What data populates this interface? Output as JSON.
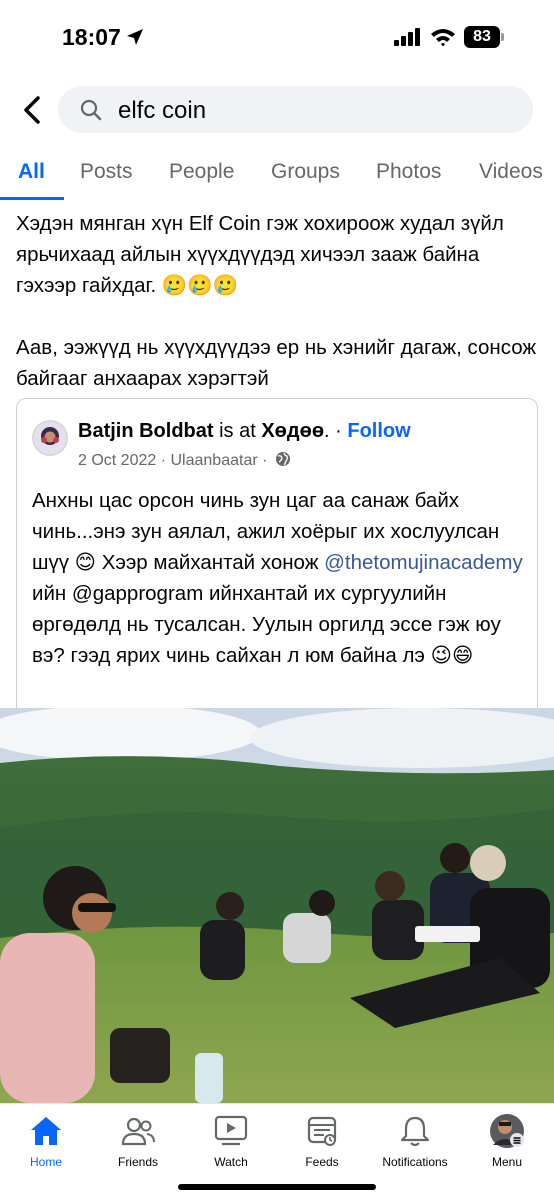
{
  "status_bar": {
    "time": "18:07",
    "battery": "83"
  },
  "search": {
    "query": "elfc coin"
  },
  "tabs": [
    {
      "label": "All",
      "active": true
    },
    {
      "label": "Posts"
    },
    {
      "label": "People"
    },
    {
      "label": "Groups"
    },
    {
      "label": "Photos"
    },
    {
      "label": "Videos"
    }
  ],
  "post": {
    "paragraph1": "Хэдэн мянган хүн Elf Coin гэж хохироож худал зүйл ярьчихаад айлын хүүхдүүдэд хичээл зааж байна гэхээр гайхдаг. 🥲🥲🥲",
    "paragraph2": "Аав, ээжүүд нь хүүхдүүдээ ер нь хэнийг дагаж, сонсож байгааг анхаарах хэрэгтэй"
  },
  "shared": {
    "author": "Batjin Boldbat",
    "is_at": " is at ",
    "place": "Хөдөө",
    "dot": ". · ",
    "follow": "Follow",
    "date": "2 Oct 2022",
    "meta_sep": " · ",
    "location": "Ulaanbaatar",
    "meta_sep2": " · ",
    "text_before": "Анхны цас орсон чинь зун цаг аа санаж байх чинь...энэ зун аялал, ажил хоёрыг их хослуулсан шүү 😊 Хээр майхантай хонож ",
    "mention": "@thetomujinacademy",
    "text_after": " ийн @gapprogram ийнхантай их сургуулийн өргөдөлд нь тусалсан. Уулын оргилд эссе гэж юу вэ? гээд ярих чинь сайхан л юм байна лэ 😉😄"
  },
  "nav": [
    {
      "label": "Home",
      "icon": "home-icon",
      "active": true
    },
    {
      "label": "Friends",
      "icon": "friends-icon"
    },
    {
      "label": "Watch",
      "icon": "watch-icon"
    },
    {
      "label": "Feeds",
      "icon": "feeds-icon"
    },
    {
      "label": "Notifications",
      "icon": "bell-icon"
    },
    {
      "label": "Menu",
      "icon": "profile-avatar"
    }
  ],
  "colors": {
    "accent": "#0866ff",
    "mention": "#385898",
    "muted": "#65676b"
  }
}
